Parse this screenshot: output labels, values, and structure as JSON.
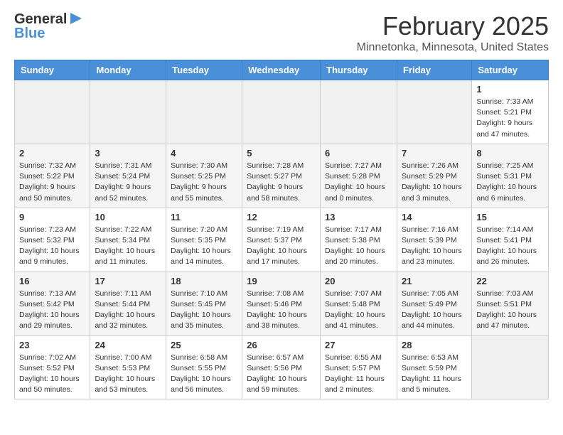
{
  "header": {
    "logo_line1": "General",
    "logo_line2": "Blue",
    "month_title": "February 2025",
    "location": "Minnetonka, Minnesota, United States"
  },
  "weekdays": [
    "Sunday",
    "Monday",
    "Tuesday",
    "Wednesday",
    "Thursday",
    "Friday",
    "Saturday"
  ],
  "weeks": [
    [
      {
        "num": "",
        "info": ""
      },
      {
        "num": "",
        "info": ""
      },
      {
        "num": "",
        "info": ""
      },
      {
        "num": "",
        "info": ""
      },
      {
        "num": "",
        "info": ""
      },
      {
        "num": "",
        "info": ""
      },
      {
        "num": "1",
        "info": "Sunrise: 7:33 AM\nSunset: 5:21 PM\nDaylight: 9 hours and 47 minutes."
      }
    ],
    [
      {
        "num": "2",
        "info": "Sunrise: 7:32 AM\nSunset: 5:22 PM\nDaylight: 9 hours and 50 minutes."
      },
      {
        "num": "3",
        "info": "Sunrise: 7:31 AM\nSunset: 5:24 PM\nDaylight: 9 hours and 52 minutes."
      },
      {
        "num": "4",
        "info": "Sunrise: 7:30 AM\nSunset: 5:25 PM\nDaylight: 9 hours and 55 minutes."
      },
      {
        "num": "5",
        "info": "Sunrise: 7:28 AM\nSunset: 5:27 PM\nDaylight: 9 hours and 58 minutes."
      },
      {
        "num": "6",
        "info": "Sunrise: 7:27 AM\nSunset: 5:28 PM\nDaylight: 10 hours and 0 minutes."
      },
      {
        "num": "7",
        "info": "Sunrise: 7:26 AM\nSunset: 5:29 PM\nDaylight: 10 hours and 3 minutes."
      },
      {
        "num": "8",
        "info": "Sunrise: 7:25 AM\nSunset: 5:31 PM\nDaylight: 10 hours and 6 minutes."
      }
    ],
    [
      {
        "num": "9",
        "info": "Sunrise: 7:23 AM\nSunset: 5:32 PM\nDaylight: 10 hours and 9 minutes."
      },
      {
        "num": "10",
        "info": "Sunrise: 7:22 AM\nSunset: 5:34 PM\nDaylight: 10 hours and 11 minutes."
      },
      {
        "num": "11",
        "info": "Sunrise: 7:20 AM\nSunset: 5:35 PM\nDaylight: 10 hours and 14 minutes."
      },
      {
        "num": "12",
        "info": "Sunrise: 7:19 AM\nSunset: 5:37 PM\nDaylight: 10 hours and 17 minutes."
      },
      {
        "num": "13",
        "info": "Sunrise: 7:17 AM\nSunset: 5:38 PM\nDaylight: 10 hours and 20 minutes."
      },
      {
        "num": "14",
        "info": "Sunrise: 7:16 AM\nSunset: 5:39 PM\nDaylight: 10 hours and 23 minutes."
      },
      {
        "num": "15",
        "info": "Sunrise: 7:14 AM\nSunset: 5:41 PM\nDaylight: 10 hours and 26 minutes."
      }
    ],
    [
      {
        "num": "16",
        "info": "Sunrise: 7:13 AM\nSunset: 5:42 PM\nDaylight: 10 hours and 29 minutes."
      },
      {
        "num": "17",
        "info": "Sunrise: 7:11 AM\nSunset: 5:44 PM\nDaylight: 10 hours and 32 minutes."
      },
      {
        "num": "18",
        "info": "Sunrise: 7:10 AM\nSunset: 5:45 PM\nDaylight: 10 hours and 35 minutes."
      },
      {
        "num": "19",
        "info": "Sunrise: 7:08 AM\nSunset: 5:46 PM\nDaylight: 10 hours and 38 minutes."
      },
      {
        "num": "20",
        "info": "Sunrise: 7:07 AM\nSunset: 5:48 PM\nDaylight: 10 hours and 41 minutes."
      },
      {
        "num": "21",
        "info": "Sunrise: 7:05 AM\nSunset: 5:49 PM\nDaylight: 10 hours and 44 minutes."
      },
      {
        "num": "22",
        "info": "Sunrise: 7:03 AM\nSunset: 5:51 PM\nDaylight: 10 hours and 47 minutes."
      }
    ],
    [
      {
        "num": "23",
        "info": "Sunrise: 7:02 AM\nSunset: 5:52 PM\nDaylight: 10 hours and 50 minutes."
      },
      {
        "num": "24",
        "info": "Sunrise: 7:00 AM\nSunset: 5:53 PM\nDaylight: 10 hours and 53 minutes."
      },
      {
        "num": "25",
        "info": "Sunrise: 6:58 AM\nSunset: 5:55 PM\nDaylight: 10 hours and 56 minutes."
      },
      {
        "num": "26",
        "info": "Sunrise: 6:57 AM\nSunset: 5:56 PM\nDaylight: 10 hours and 59 minutes."
      },
      {
        "num": "27",
        "info": "Sunrise: 6:55 AM\nSunset: 5:57 PM\nDaylight: 11 hours and 2 minutes."
      },
      {
        "num": "28",
        "info": "Sunrise: 6:53 AM\nSunset: 5:59 PM\nDaylight: 11 hours and 5 minutes."
      },
      {
        "num": "",
        "info": ""
      }
    ]
  ]
}
